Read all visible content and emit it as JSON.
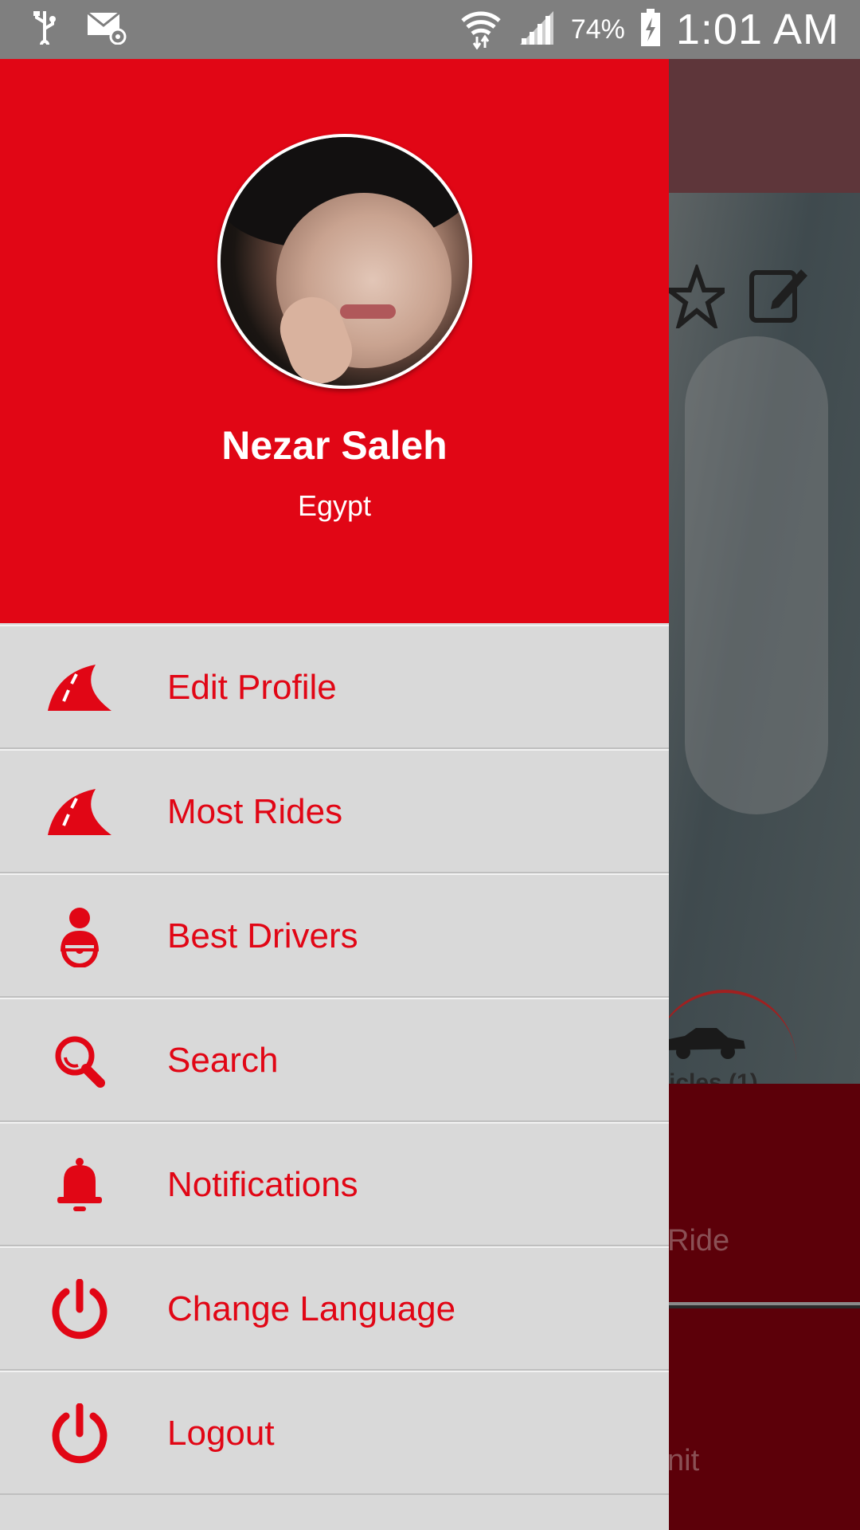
{
  "status_bar": {
    "battery_percent": "74%",
    "time": "1:01 AM",
    "icons": [
      "usb-icon",
      "email-icon",
      "wifi-icon",
      "signal-icon",
      "battery-charging-icon"
    ]
  },
  "background_app": {
    "vehicles_label": "icles (1)",
    "ride_label": "Ride",
    "bottom_label": "nit"
  },
  "drawer": {
    "profile": {
      "name": "Nezar Saleh",
      "country": "Egypt"
    },
    "menu": [
      {
        "label": "Edit Profile",
        "icon": "road-icon"
      },
      {
        "label": "Most Rides",
        "icon": "road-icon"
      },
      {
        "label": "Best Drivers",
        "icon": "driver-icon"
      },
      {
        "label": "Search",
        "icon": "search-icon"
      },
      {
        "label": "Notifications",
        "icon": "bell-icon"
      },
      {
        "label": "Change Language",
        "icon": "power-icon"
      },
      {
        "label": "Logout",
        "icon": "power-icon"
      }
    ]
  },
  "colors": {
    "accent": "#e10615",
    "drawer_bg": "#d9d9d9",
    "status_bar": "#7f7f7f"
  }
}
